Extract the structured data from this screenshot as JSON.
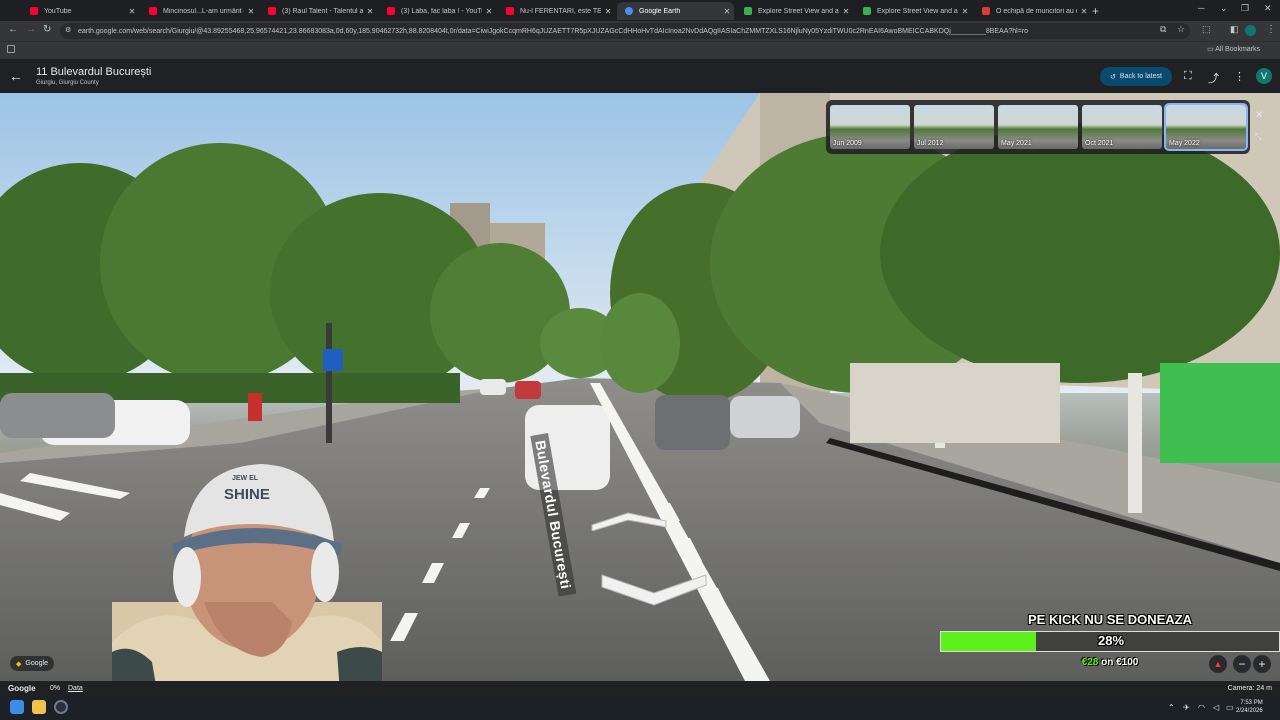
{
  "browser": {
    "tabs": [
      {
        "title": "YouTube",
        "icon": "youtube-icon"
      },
      {
        "title": "Mincinosul...L-am urmărit doua",
        "icon": "youtube-icon"
      },
      {
        "title": "(3) Raul Talent - Talentul ala fi",
        "icon": "youtube-icon"
      },
      {
        "title": "(3) Laba, fac laba ! - YouTube",
        "icon": "youtube-icon"
      },
      {
        "title": "Nu-l FERENTARI, este TEI TOBO",
        "icon": "youtube-icon"
      },
      {
        "title": "Google Earth",
        "icon": "google-earth-icon",
        "active": true
      },
      {
        "title": "Explore Street View and add yo",
        "icon": "google-icon"
      },
      {
        "title": "Explore Street View and add yo",
        "icon": "google-icon"
      },
      {
        "title": "O echipă de muncitori au dărâ",
        "icon": "news-icon"
      }
    ],
    "url": "earth.google.com/web/search/Giurgiu/@43.89255468,25.96574421,23.86683083a,0d,60y,185.90462732h,88.8208404t,0r/data=CiwiJgokCcqmRH6qJUZAETT7R5pXJUZAGcCdHHoHvTdAIcInoa2NvDdAQgIIASIaChZMMTZXLS16NjluNy05YzdiTWU0c2RnEAI6AwoBMEICCABKDQj_________8BEAA?hl=ro",
    "bookmarks_label": "All Bookmarks"
  },
  "earth": {
    "place_title": "11 Bulevardul București",
    "place_subtitle": "Giurgiu, Giurgiu County",
    "back_to_latest": "Back to latest",
    "timeline": [
      {
        "label": "Jun 2009",
        "selected": false
      },
      {
        "label": "Jul 2012",
        "selected": false
      },
      {
        "label": "May 2021",
        "selected": false
      },
      {
        "label": "Oct 2021",
        "selected": false
      },
      {
        "label": "May 2022",
        "selected": true
      }
    ],
    "street_label": "Bulevardul București",
    "google_badge": "Google",
    "status_left": "Google",
    "status_pct": "0%",
    "status_data": "Data",
    "camera": "Camera: 24 m"
  },
  "overlay": {
    "cap_text_top": "JEW EL",
    "cap_text_main": "SHINE",
    "donation": {
      "title": "PE KICK NU SE DONEAZA",
      "percent_label": "28%",
      "progress": 0.28,
      "current": "€28",
      "on": "on",
      "goal": "€100"
    }
  },
  "taskbar": {
    "time": "7:53 PM",
    "date": "2/24/2026"
  }
}
